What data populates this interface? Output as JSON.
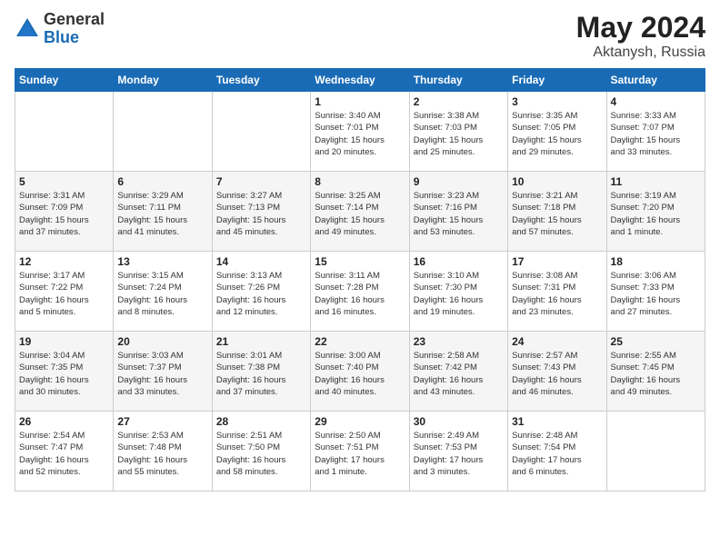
{
  "logo": {
    "general": "General",
    "blue": "Blue",
    "icon": "▶"
  },
  "title": "May 2024",
  "subtitle": "Aktanysh, Russia",
  "weekdays": [
    "Sunday",
    "Monday",
    "Tuesday",
    "Wednesday",
    "Thursday",
    "Friday",
    "Saturday"
  ],
  "weeks": [
    [
      {
        "day": "",
        "info": ""
      },
      {
        "day": "",
        "info": ""
      },
      {
        "day": "",
        "info": ""
      },
      {
        "day": "1",
        "info": "Sunrise: 3:40 AM\nSunset: 7:01 PM\nDaylight: 15 hours\nand 20 minutes."
      },
      {
        "day": "2",
        "info": "Sunrise: 3:38 AM\nSunset: 7:03 PM\nDaylight: 15 hours\nand 25 minutes."
      },
      {
        "day": "3",
        "info": "Sunrise: 3:35 AM\nSunset: 7:05 PM\nDaylight: 15 hours\nand 29 minutes."
      },
      {
        "day": "4",
        "info": "Sunrise: 3:33 AM\nSunset: 7:07 PM\nDaylight: 15 hours\nand 33 minutes."
      }
    ],
    [
      {
        "day": "5",
        "info": "Sunrise: 3:31 AM\nSunset: 7:09 PM\nDaylight: 15 hours\nand 37 minutes."
      },
      {
        "day": "6",
        "info": "Sunrise: 3:29 AM\nSunset: 7:11 PM\nDaylight: 15 hours\nand 41 minutes."
      },
      {
        "day": "7",
        "info": "Sunrise: 3:27 AM\nSunset: 7:13 PM\nDaylight: 15 hours\nand 45 minutes."
      },
      {
        "day": "8",
        "info": "Sunrise: 3:25 AM\nSunset: 7:14 PM\nDaylight: 15 hours\nand 49 minutes."
      },
      {
        "day": "9",
        "info": "Sunrise: 3:23 AM\nSunset: 7:16 PM\nDaylight: 15 hours\nand 53 minutes."
      },
      {
        "day": "10",
        "info": "Sunrise: 3:21 AM\nSunset: 7:18 PM\nDaylight: 15 hours\nand 57 minutes."
      },
      {
        "day": "11",
        "info": "Sunrise: 3:19 AM\nSunset: 7:20 PM\nDaylight: 16 hours\nand 1 minute."
      }
    ],
    [
      {
        "day": "12",
        "info": "Sunrise: 3:17 AM\nSunset: 7:22 PM\nDaylight: 16 hours\nand 5 minutes."
      },
      {
        "day": "13",
        "info": "Sunrise: 3:15 AM\nSunset: 7:24 PM\nDaylight: 16 hours\nand 8 minutes."
      },
      {
        "day": "14",
        "info": "Sunrise: 3:13 AM\nSunset: 7:26 PM\nDaylight: 16 hours\nand 12 minutes."
      },
      {
        "day": "15",
        "info": "Sunrise: 3:11 AM\nSunset: 7:28 PM\nDaylight: 16 hours\nand 16 minutes."
      },
      {
        "day": "16",
        "info": "Sunrise: 3:10 AM\nSunset: 7:30 PM\nDaylight: 16 hours\nand 19 minutes."
      },
      {
        "day": "17",
        "info": "Sunrise: 3:08 AM\nSunset: 7:31 PM\nDaylight: 16 hours\nand 23 minutes."
      },
      {
        "day": "18",
        "info": "Sunrise: 3:06 AM\nSunset: 7:33 PM\nDaylight: 16 hours\nand 27 minutes."
      }
    ],
    [
      {
        "day": "19",
        "info": "Sunrise: 3:04 AM\nSunset: 7:35 PM\nDaylight: 16 hours\nand 30 minutes."
      },
      {
        "day": "20",
        "info": "Sunrise: 3:03 AM\nSunset: 7:37 PM\nDaylight: 16 hours\nand 33 minutes."
      },
      {
        "day": "21",
        "info": "Sunrise: 3:01 AM\nSunset: 7:38 PM\nDaylight: 16 hours\nand 37 minutes."
      },
      {
        "day": "22",
        "info": "Sunrise: 3:00 AM\nSunset: 7:40 PM\nDaylight: 16 hours\nand 40 minutes."
      },
      {
        "day": "23",
        "info": "Sunrise: 2:58 AM\nSunset: 7:42 PM\nDaylight: 16 hours\nand 43 minutes."
      },
      {
        "day": "24",
        "info": "Sunrise: 2:57 AM\nSunset: 7:43 PM\nDaylight: 16 hours\nand 46 minutes."
      },
      {
        "day": "25",
        "info": "Sunrise: 2:55 AM\nSunset: 7:45 PM\nDaylight: 16 hours\nand 49 minutes."
      }
    ],
    [
      {
        "day": "26",
        "info": "Sunrise: 2:54 AM\nSunset: 7:47 PM\nDaylight: 16 hours\nand 52 minutes."
      },
      {
        "day": "27",
        "info": "Sunrise: 2:53 AM\nSunset: 7:48 PM\nDaylight: 16 hours\nand 55 minutes."
      },
      {
        "day": "28",
        "info": "Sunrise: 2:51 AM\nSunset: 7:50 PM\nDaylight: 16 hours\nand 58 minutes."
      },
      {
        "day": "29",
        "info": "Sunrise: 2:50 AM\nSunset: 7:51 PM\nDaylight: 17 hours\nand 1 minute."
      },
      {
        "day": "30",
        "info": "Sunrise: 2:49 AM\nSunset: 7:53 PM\nDaylight: 17 hours\nand 3 minutes."
      },
      {
        "day": "31",
        "info": "Sunrise: 2:48 AM\nSunset: 7:54 PM\nDaylight: 17 hours\nand 6 minutes."
      },
      {
        "day": "",
        "info": ""
      }
    ]
  ]
}
